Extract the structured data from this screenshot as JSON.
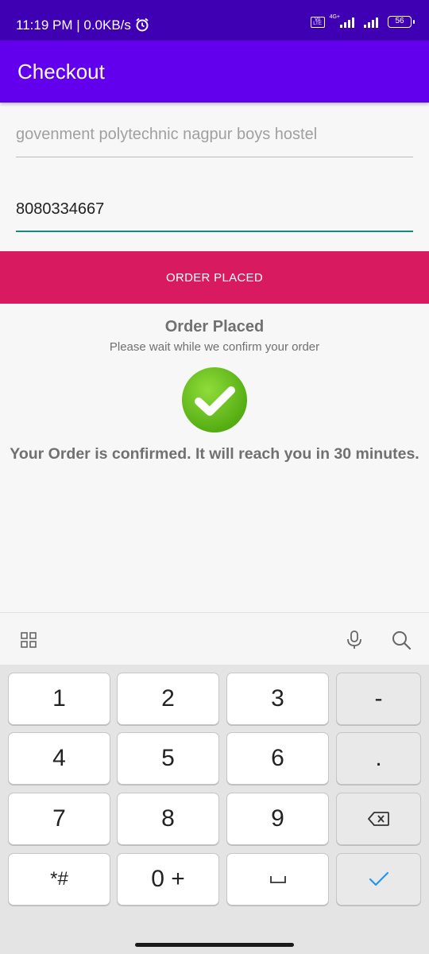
{
  "status_bar": {
    "time": "11:19 PM | 0.0KB/s",
    "volte": "Vo LTE",
    "network": "4G+",
    "battery": "56"
  },
  "app_bar": {
    "title": "Checkout"
  },
  "form": {
    "address_placeholder": "govenment polytechnic nagpur boys hostel",
    "phone_value": "8080334667"
  },
  "order_button_label": "ORDER PLACED",
  "confirmation": {
    "title": "Order Placed",
    "subtitle": "Please wait while we confirm your order",
    "message": "Your Order is confirmed. It will reach you in 30 minutes."
  },
  "keyboard": {
    "toolbar_icons": [
      "apps-grid-icon",
      "microphone-icon",
      "search-icon"
    ],
    "rows": [
      [
        "1",
        "2",
        "3",
        "-"
      ],
      [
        "4",
        "5",
        "6",
        "."
      ],
      [
        "7",
        "8",
        "9",
        "backspace"
      ],
      [
        "*#",
        "0 +",
        "space",
        "done"
      ]
    ],
    "done_color": "#2196f3"
  },
  "colors": {
    "status_bar": "#3f00b3",
    "app_bar": "#6200ee",
    "order_button": "#d81b60",
    "input_focus_line": "#168a7c",
    "check_green": "#6cc417"
  }
}
